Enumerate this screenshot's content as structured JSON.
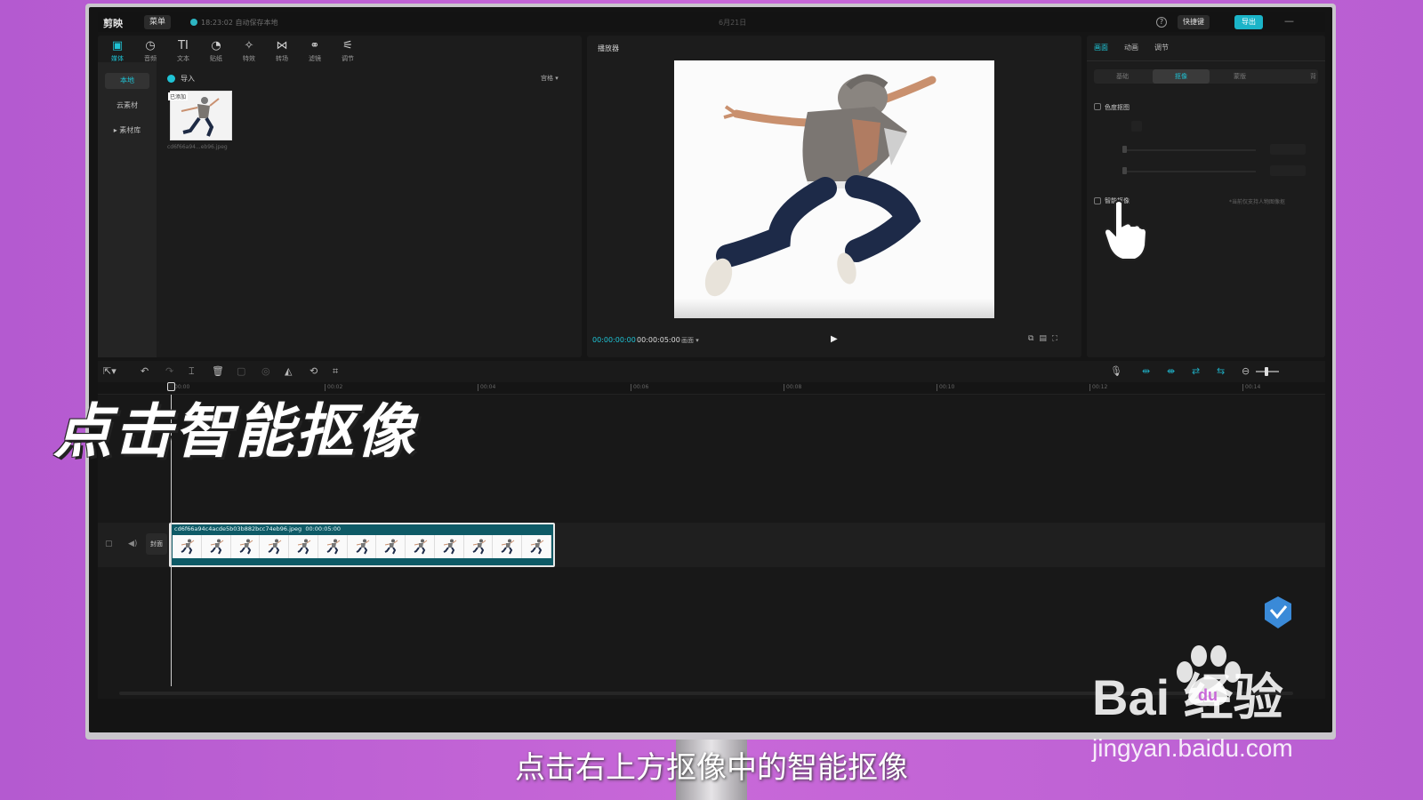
{
  "window": {
    "logo": "剪映",
    "menu_label": "菜单",
    "autosave_text": "18:23:02 自动保存本地",
    "project_title": "6月21日",
    "shortcut_label": "快捷键",
    "export_label": "导出"
  },
  "media_tools": [
    {
      "icon": "media-icon",
      "glyph": "▣",
      "label": "媒体"
    },
    {
      "icon": "audio-icon",
      "glyph": "◷",
      "label": "音频"
    },
    {
      "icon": "text-icon",
      "glyph": "TI",
      "label": "文本"
    },
    {
      "icon": "sticker-icon",
      "glyph": "◔",
      "label": "贴纸"
    },
    {
      "icon": "effects-icon",
      "glyph": "✧",
      "label": "特效"
    },
    {
      "icon": "transition-icon",
      "glyph": "⋈",
      "label": "转场"
    },
    {
      "icon": "filter-icon",
      "glyph": "⚭",
      "label": "滤镜"
    },
    {
      "icon": "adjust-icon",
      "glyph": "⚟",
      "label": "调节"
    }
  ],
  "left_nav": [
    "本地",
    "云素材",
    "▸ 素材库"
  ],
  "media": {
    "import_label": "导入",
    "sort_label": "宫格 ▾",
    "thumb_tag": "已添加",
    "thumb_caption": "cd6f66a94...eb96.jpeg"
  },
  "player": {
    "title": "播放器",
    "current_time": "00:00:00:00",
    "total_time": "00:00:05:00",
    "ratio_label": "画面 ▾"
  },
  "right_panel": {
    "tabs": [
      "画面",
      "动画",
      "调节"
    ],
    "segments": [
      "基础",
      "抠像",
      "蒙版",
      "背"
    ],
    "chroma_key_label": "色度抠图",
    "smart_cutout_label": "智能抠像",
    "smart_cutout_hint": "*当前仅支持人物图像抠"
  },
  "ruler_ticks": [
    "00:00",
    "00:02",
    "00:04",
    "00:06",
    "00:08",
    "00:10",
    "00:12",
    "00:14"
  ],
  "timeline": {
    "cover_label": "封面",
    "clip_name": "cd6f66a94c4acde5b03b882bcc74eb96.jpeg",
    "clip_duration": "00:00:05:00"
  },
  "overlay": {
    "big_caption": "点击智能抠像",
    "subtitle": "点击右上方抠像中的智能抠像",
    "watermark_main": "Bai  经验",
    "watermark_url": "jingyan.baidu.com"
  },
  "colors": {
    "accent": "#1fc3d5",
    "clip": "#0e5a66",
    "background": "#c868d8"
  }
}
